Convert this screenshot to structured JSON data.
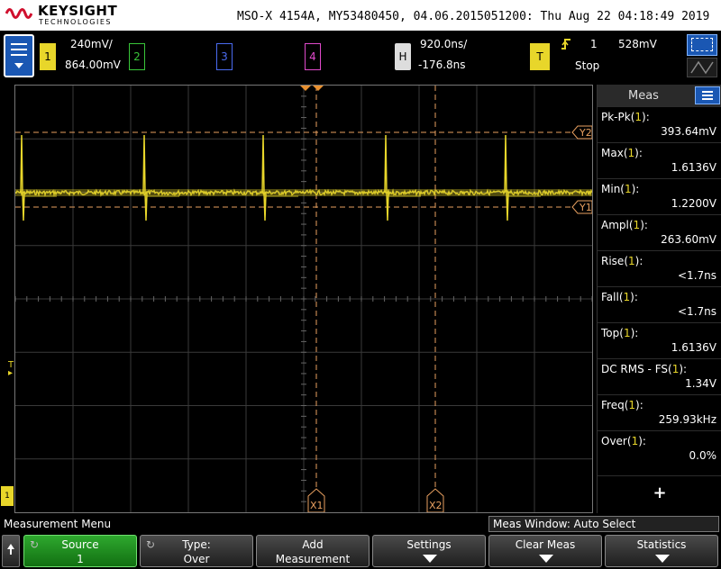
{
  "header": {
    "brand": "KEYSIGHT",
    "brand_sub": "TECHNOLOGIES",
    "instrument": "MSO-X 4154A, MY53480450, 04.06.2015051200: Thu Aug 22 04:18:49 2019"
  },
  "channels": {
    "ch1": {
      "label": "1",
      "scale": "240mV/",
      "offset": "864.00mV"
    },
    "ch2": {
      "label": "2"
    },
    "ch3": {
      "label": "3"
    },
    "ch4": {
      "label": "4"
    }
  },
  "horizontal": {
    "label": "H",
    "timebase": "920.0ns/",
    "delay": "-176.8ns"
  },
  "trigger": {
    "label": "T",
    "source": "1",
    "level": "528mV",
    "status": "Stop"
  },
  "markers": {
    "y1": "Y1",
    "y2": "Y2",
    "x1": "X1",
    "x2": "X2",
    "trig_marker": "T",
    "ground_marker": "1"
  },
  "measurements_panel": {
    "title": "Meas",
    "items": [
      {
        "name": "Pk-Pk",
        "ch": "1",
        "value": "393.64mV"
      },
      {
        "name": "Max",
        "ch": "1",
        "value": "1.6136V"
      },
      {
        "name": "Min",
        "ch": "1",
        "value": "1.2200V"
      },
      {
        "name": "Ampl",
        "ch": "1",
        "value": "263.60mV"
      },
      {
        "name": "Rise",
        "ch": "1",
        "value": "<1.7ns"
      },
      {
        "name": "Fall",
        "ch": "1",
        "value": "<1.7ns"
      },
      {
        "name": "Top",
        "ch": "1",
        "value": "1.6136V"
      },
      {
        "name": "DC RMS - FS",
        "ch": "1",
        "value": "1.34V"
      },
      {
        "name": "Freq",
        "ch": "1",
        "value": "259.93kHz"
      },
      {
        "name": "Over",
        "ch": "1",
        "value": "0.0%"
      }
    ],
    "add_symbol": "+"
  },
  "menu": {
    "name": "Measurement Menu",
    "meas_window": "Meas Window: Auto Select",
    "softkeys": [
      {
        "l1": "Source",
        "l2": "1"
      },
      {
        "l1": "Type:",
        "l2": "Over"
      },
      {
        "l1": "Add",
        "l2": "Measurement"
      },
      {
        "l1": "Settings"
      },
      {
        "l1": "Clear Meas"
      },
      {
        "l1": "Statistics"
      }
    ]
  },
  "colors": {
    "ch1": "#e8d62a",
    "ch2": "#39c639",
    "ch3": "#4a6bf0",
    "ch4": "#e04acb",
    "cursor": "#e8a060",
    "active_key": "#2ea82e",
    "menu_blue": "#1a57b3"
  },
  "icons": {
    "menu": "hamburger-icon",
    "trigger_edge": "rising-edge-icon",
    "back": "up-arrow-icon",
    "cycle": "cycle-arrow-icon",
    "down": "down-arrow-icon"
  }
}
